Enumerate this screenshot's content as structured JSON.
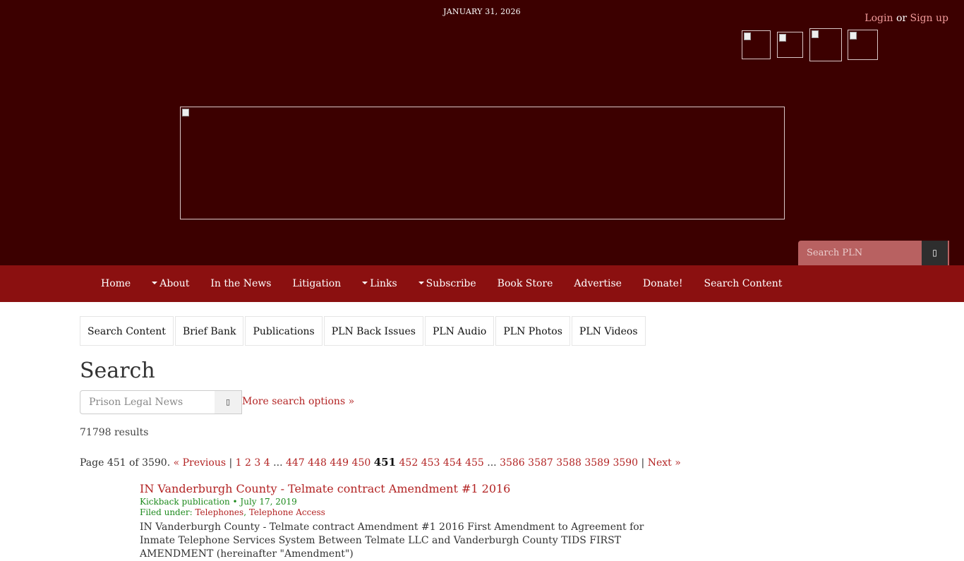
{
  "header": {
    "date": "JANUARY 31, 2026",
    "login_label": "Login",
    "or_label": "or",
    "signup_label": "Sign up",
    "search_placeholder": "Search PLN"
  },
  "social_icons": [
    "facebook-icon",
    "twitter-icon",
    "youtube-icon",
    "rss-icon"
  ],
  "nav": {
    "items": [
      {
        "label": "Home",
        "dropdown": false
      },
      {
        "label": "About",
        "dropdown": true
      },
      {
        "label": "In the News",
        "dropdown": false
      },
      {
        "label": "Litigation",
        "dropdown": false
      },
      {
        "label": "Links",
        "dropdown": true
      },
      {
        "label": "Subscribe",
        "dropdown": true
      },
      {
        "label": "Book Store",
        "dropdown": false
      },
      {
        "label": "Advertise",
        "dropdown": false
      },
      {
        "label": "Donate!",
        "dropdown": false
      },
      {
        "label": "Search Content",
        "dropdown": false
      }
    ]
  },
  "subtabs": [
    "Search Content",
    "Brief Bank",
    "Publications",
    "PLN Back Issues",
    "PLN Audio",
    "PLN Photos",
    "PLN Videos"
  ],
  "search": {
    "heading": "Search",
    "placeholder": "Prison Legal News",
    "more_options": "More search options »",
    "results_count": "71798 results"
  },
  "pager": {
    "prefix": "Page 451 of 3590.",
    "previous": "« Previous",
    "sep": "|",
    "first_pages": [
      "1",
      "2",
      "3",
      "4"
    ],
    "ellipsis": "...",
    "before_pages": [
      "447",
      "448",
      "449",
      "450"
    ],
    "current": "451",
    "after_pages": [
      "452",
      "453",
      "454",
      "455"
    ],
    "last_pages": [
      "3586",
      "3587",
      "3588",
      "3589",
      "3590"
    ],
    "next": "Next »"
  },
  "result": {
    "title": "IN Vanderburgh County - Telmate contract Amendment #1 2016",
    "meta": "Kickback publication • July 17, 2019",
    "filed_label": "Filed under:",
    "filed_tags": [
      "Telephones",
      "Telephone Access"
    ],
    "description": "IN Vanderburgh County - Telmate contract Amendment #1 2016 First Amendment to Agreement for Inmate Telephone Services System Between Telmate LLC and Vanderburgh County TIDS FIRST AMENDMENT (hereinafter \"Amendment\")"
  },
  "colors": {
    "header_bg": "#3c0000",
    "nav_bg": "#8b1010",
    "link": "#b32424",
    "meta_green": "#1d8a1d"
  }
}
